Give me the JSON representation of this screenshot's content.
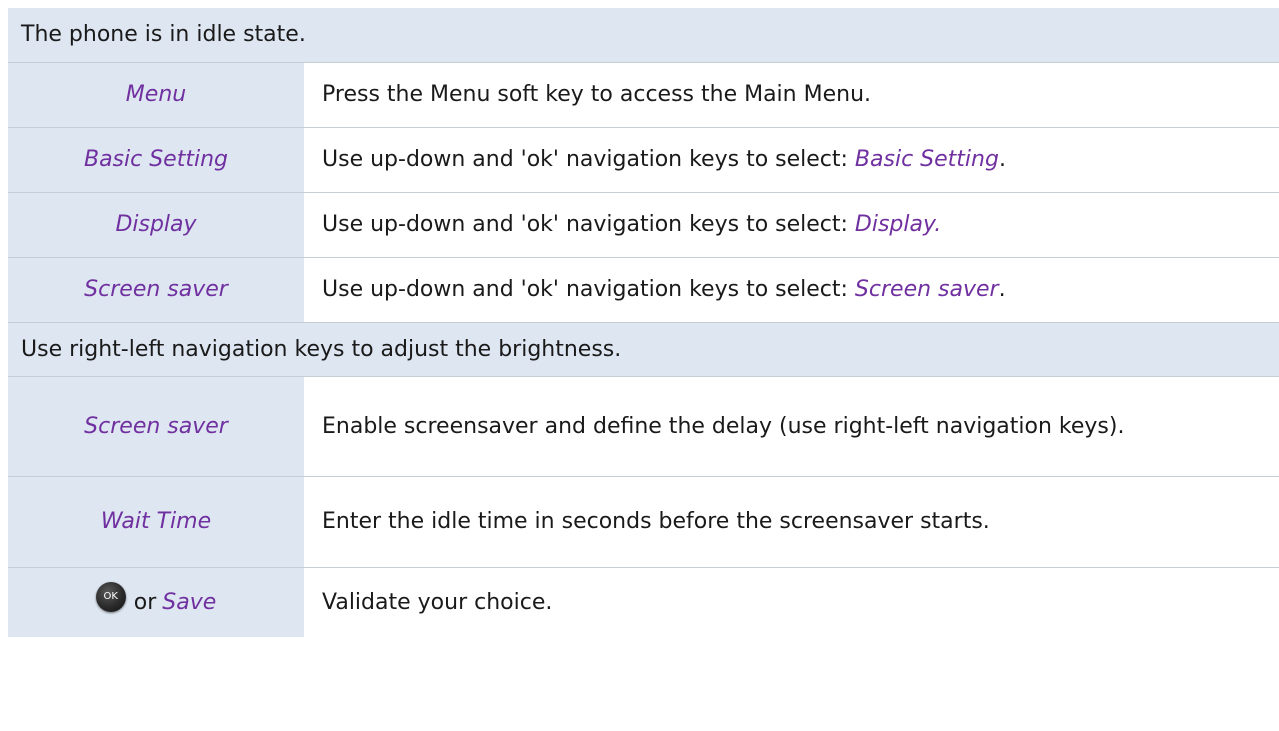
{
  "rows": [
    {
      "type": "full",
      "text": "The phone is in idle state."
    },
    {
      "type": "step",
      "label": "Menu",
      "desc": "Press the Menu soft key to access the Main Menu."
    },
    {
      "type": "step",
      "label": "Basic Setting",
      "desc_prefix": "Use up-down and 'ok' navigation keys to select: ",
      "desc_ref": "Basic Setting",
      "desc_suffix": "."
    },
    {
      "type": "step",
      "label": "Display",
      "desc_prefix": "Use up-down and 'ok' navigation keys to select: ",
      "desc_ref": "Display.",
      "desc_suffix": ""
    },
    {
      "type": "step",
      "label": "Screen saver",
      "desc_prefix": "Use up-down and 'ok' navigation keys to select: ",
      "desc_ref": "Screen saver",
      "desc_suffix": "."
    },
    {
      "type": "full",
      "text": "Use right-left navigation keys to adjust the brightness."
    },
    {
      "type": "step",
      "label": "Screen saver",
      "desc": "Enable screensaver and define the delay (use right-left navigation keys)."
    },
    {
      "type": "step",
      "label": "Wait Time",
      "desc": "Enter the idle time in seconds before the screensaver starts."
    },
    {
      "type": "step",
      "ok_key_label": "OK",
      "or_text": "or",
      "label": "Save",
      "desc": "Validate your choice."
    }
  ],
  "colors": {
    "label_bg": "#dde6f1",
    "accent_text": "#7030a0",
    "border": "#c5cdd6"
  },
  "icons": {
    "ok_key": "ok-button-icon"
  }
}
